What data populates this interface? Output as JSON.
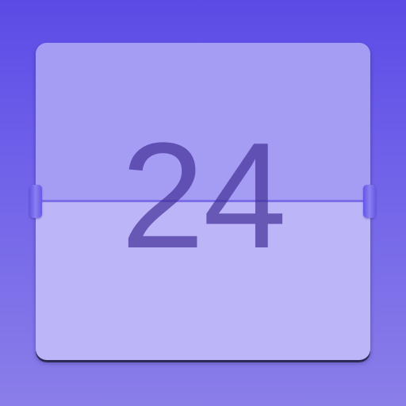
{
  "calendar_icon": {
    "day_number": "24",
    "colors": {
      "background_top": "#5b4be6",
      "background_bottom": "#8a7ee9",
      "card_upper_half": "#a59cf3",
      "card_lower_half": "#bcb5f8",
      "digits": "#4a3a9c",
      "hinge_tabs": "#6d5fe9"
    },
    "icons": [
      "flip-calendar-card",
      "hinge-tab-left",
      "hinge-tab-right"
    ]
  }
}
